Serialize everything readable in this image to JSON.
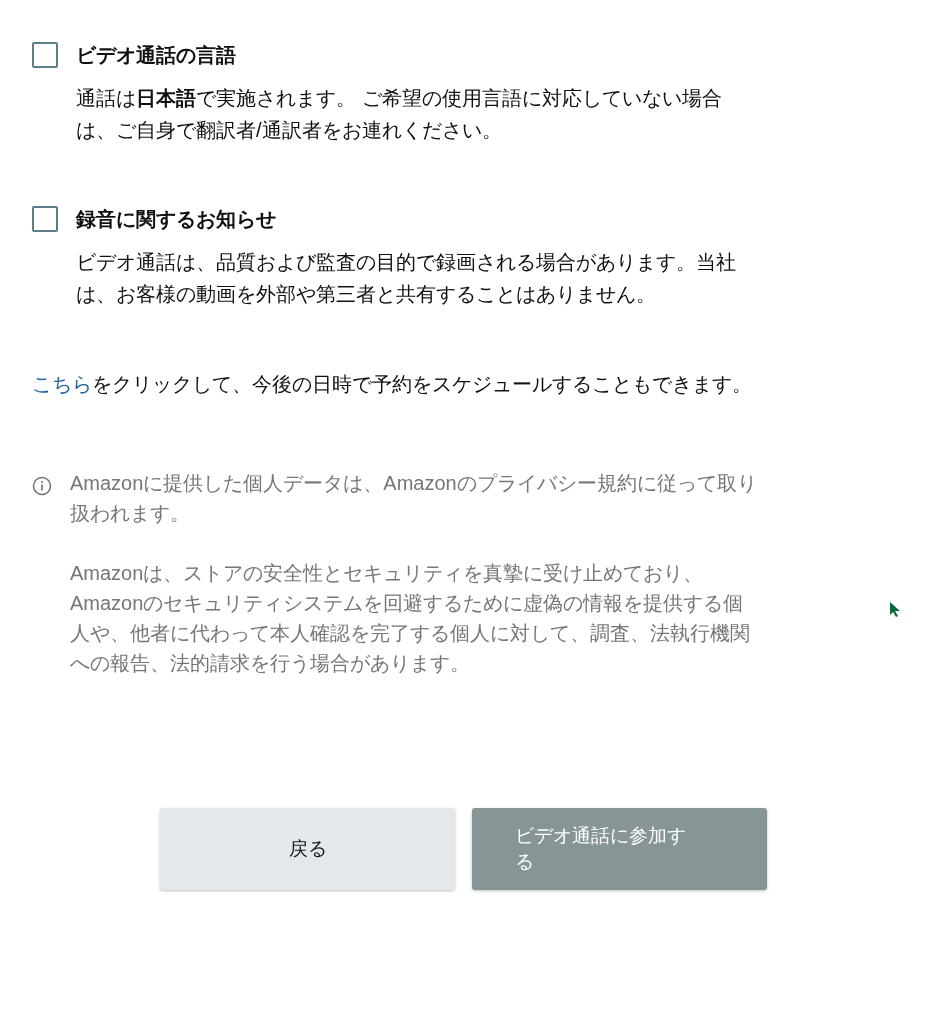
{
  "notices": [
    {
      "title": "ビデオ通話の言語",
      "checked": false,
      "body": "通話は**日本語**で実施されます。 ご希望の使用言語に対応していない場合は、ご自身で翻訳者/通訳者をお連れください。"
    },
    {
      "title": "録音に関するお知らせ",
      "checked": false,
      "body": "ビデオ通話は、品質および監査の目的で録画される場合があります。当社は、お客様の動画を外部や第三者と共有することはありません。"
    }
  ],
  "schedule": {
    "link": "こちら",
    "text": "をクリックして、今後の日時で予約をスケジュールすることもできます。"
  },
  "info": [
    "Amazonに提供した個人データは、Amazonのプライバシー規約に従って取り扱われます。",
    "Amazonは、ストアの安全性とセキュリティを真摯に受け止めており、Amazonのセキュリティシステムを回避するために虚偽の情報を提供する個人や、他者に代わって本人確認を完了する個人に対して、調査、法執行機関への報告、法的請求を行う場合があります。"
  ],
  "buttons": [
    {
      "label": "戻る",
      "kind": "secondary",
      "disabled": false
    },
    {
      "label": "ビデオ通話に参加する",
      "kind": "primary",
      "disabled": true
    }
  ]
}
